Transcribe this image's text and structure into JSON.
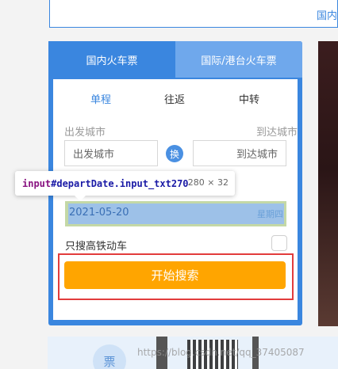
{
  "top_card": {
    "link_text": "国内"
  },
  "tabs": [
    {
      "label": "国内火车票",
      "active": true
    },
    {
      "label": "国际/港台火车票",
      "active": false
    }
  ],
  "modes": [
    {
      "label": "单程",
      "selected": true
    },
    {
      "label": "往返",
      "selected": false
    },
    {
      "label": "中转",
      "selected": false
    }
  ],
  "from": {
    "label": "出发城市",
    "placeholder": "出发城市"
  },
  "to": {
    "label": "到达城市",
    "placeholder": "到达城市"
  },
  "swap_label": "换",
  "inspector_tooltip": {
    "tag": "input",
    "selector": "#departDate.input_txt270",
    "size": "280 × 32"
  },
  "depart_date": {
    "value": "2021-05-20",
    "weekday": "星期四"
  },
  "highspeed_only": {
    "label": "只搜高铁动车",
    "checked": false
  },
  "search_button": {
    "label": "开始搜索"
  },
  "bottom_promo": {
    "icon_char": "票"
  },
  "watermark": "https://blog.csdn.net/qq_37405087",
  "colors": {
    "accent": "#3a86df",
    "button": "#ffa500",
    "highlight": "#e23c3c"
  }
}
